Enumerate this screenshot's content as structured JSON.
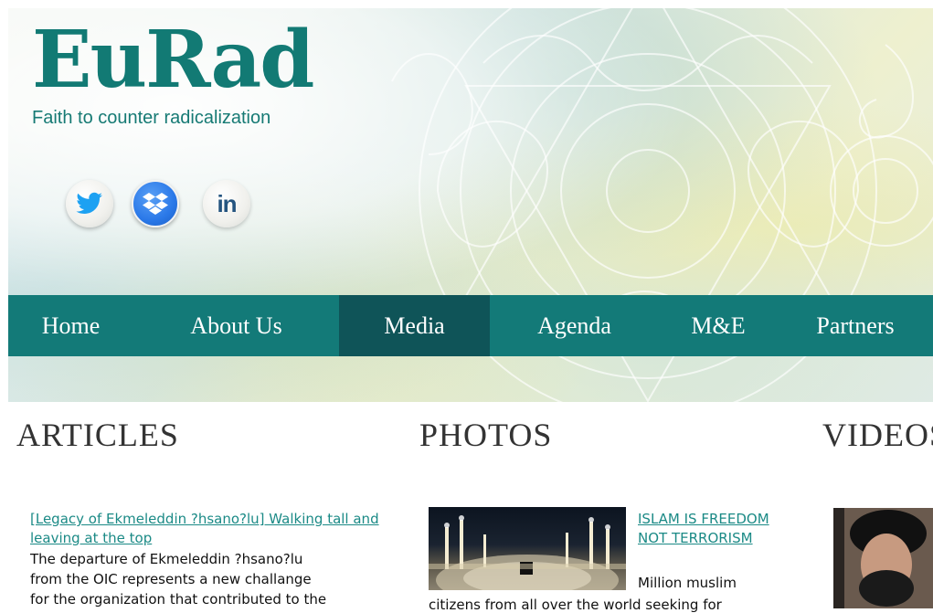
{
  "brand": {
    "title": "EuRad",
    "tagline": "Faith to counter radicalization",
    "accent_color": "#137a78",
    "active_color": "#0f5458",
    "link_color": "#1b8a86"
  },
  "social": [
    {
      "name": "twitter-icon",
      "icon": "twitter-bird"
    },
    {
      "name": "dropbox-icon",
      "icon": "dropbox-box"
    },
    {
      "name": "linkedin-icon",
      "icon": "linkedin-in",
      "label": "in"
    }
  ],
  "nav": {
    "items": [
      {
        "label": "Home"
      },
      {
        "label": "About Us"
      },
      {
        "label": "Media",
        "active": true
      },
      {
        "label": "Agenda"
      },
      {
        "label": "M&E"
      },
      {
        "label": "Partners"
      }
    ]
  },
  "sections": {
    "articles": "ARTICLES",
    "photos": "PHOTOS",
    "videos": "VIDEOS"
  },
  "article": {
    "title": "[Legacy of Ekmeleddin ?hsano?lu] Walking tall and leaving at the top",
    "body_line1": "The departure of Ekmeleddin ?hsano?lu",
    "body_line2": "from the OIC represents a new challange",
    "body_line3": "for the organization that contributed to the"
  },
  "photo": {
    "title": "ISLAM IS FREEDOM NOT TERRORISM",
    "inline": "Million muslim",
    "body": "citizens from all over the world seeking for"
  }
}
